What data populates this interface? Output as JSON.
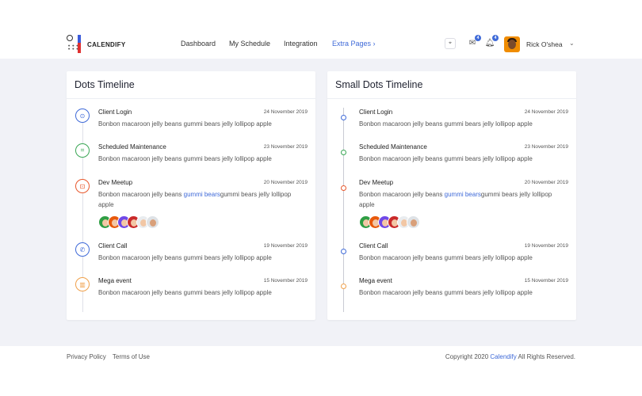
{
  "brand": {
    "name": "CALENDIFY"
  },
  "nav": [
    {
      "label": "Dashboard"
    },
    {
      "label": "My Schedule"
    },
    {
      "label": "Integration"
    },
    {
      "label": "Extra Pages",
      "arrow": "›"
    }
  ],
  "header": {
    "messages_badge": "4",
    "notifications_badge": "4",
    "user_name": "Rick O'shea"
  },
  "colors": {
    "accent": "#3f6ad8",
    "blue": "#3f6ad8",
    "green": "#3aa655",
    "red": "#e8572c",
    "orange": "#f0a04b"
  },
  "cards": [
    {
      "title": "Dots Timeline",
      "items": [
        {
          "title": "Client Login",
          "date": "24 November 2019",
          "desc_pre": "Bonbon macaroon jelly beans gummi bears jelly lollipop apple",
          "icon": "target-icon",
          "color": "blue"
        },
        {
          "title": "Scheduled Maintenance",
          "date": "23 November 2019",
          "desc_pre": "Bonbon macaroon jelly beans gummi bears jelly lollipop apple",
          "icon": "crop-icon",
          "color": "green"
        },
        {
          "title": "Dev Meetup",
          "date": "20 November 2019",
          "desc_pre": "Bonbon macaroon jelly beans ",
          "desc_link": "gummi bears",
          "desc_post": "gummi bears jelly lollipop apple",
          "icon": "lock-icon",
          "color": "red"
        },
        {
          "title": "Client Call",
          "date": "19 November 2019",
          "desc_pre": "Bonbon macaroon jelly beans gummi bears jelly lollipop apple",
          "icon": "phone-icon",
          "color": "blue"
        },
        {
          "title": "Mega event",
          "date": "15 November 2019",
          "desc_pre": "Bonbon macaroon jelly beans gummi bears jelly lollipop apple",
          "icon": "gift-icon",
          "color": "orange"
        }
      ]
    },
    {
      "title": "Small Dots Timeline",
      "items": [
        {
          "title": "Client Login",
          "date": "24 November 2019",
          "desc_pre": "Bonbon macaroon jelly beans gummi bears jelly lollipop apple",
          "color": "blue"
        },
        {
          "title": "Scheduled Maintenance",
          "date": "23 November 2019",
          "desc_pre": "Bonbon macaroon jelly beans gummi bears jelly lollipop apple",
          "color": "green"
        },
        {
          "title": "Dev Meetup",
          "date": "20 November 2019",
          "desc_pre": "Bonbon macaroon jelly beans ",
          "desc_link": "gummi bears",
          "desc_post": "gummi bears jelly lollipop apple",
          "color": "red"
        },
        {
          "title": "Client Call",
          "date": "19 November 2019",
          "desc_pre": "Bonbon macaroon jelly beans gummi bears jelly lollipop apple",
          "color": "blue"
        },
        {
          "title": "Mega event",
          "date": "15 November 2019",
          "desc_pre": "Bonbon macaroon jelly beans gummi bears jelly lollipop apple",
          "color": "orange"
        }
      ]
    }
  ],
  "footer": {
    "links": [
      "Privacy Policy",
      "Terms of Use"
    ],
    "copyright_pre": "Copyright 2020 ",
    "copyright_brand": "Calendify",
    "copyright_post": " All Rights Reserved."
  }
}
